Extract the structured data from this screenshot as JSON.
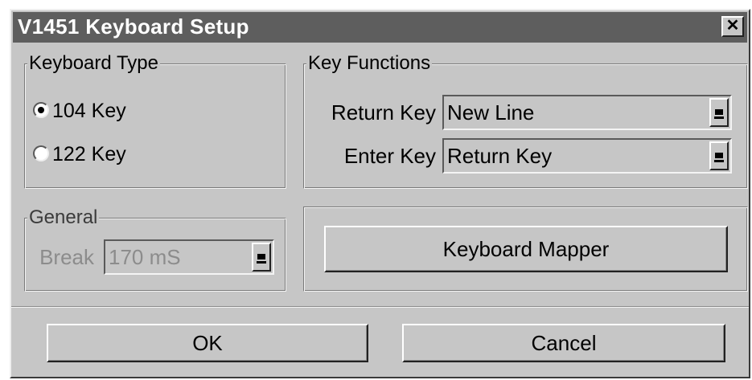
{
  "window": {
    "title": "V1451 Keyboard Setup",
    "close_glyph": "✕"
  },
  "keyboard_type": {
    "legend": "Keyboard Type",
    "options": [
      {
        "label": "104 Key",
        "checked": true
      },
      {
        "label": "122 Key",
        "checked": false
      }
    ]
  },
  "key_functions": {
    "legend": "Key Functions",
    "return_key": {
      "label": "Return Key",
      "value": "New Line"
    },
    "enter_key": {
      "label": "Enter Key",
      "value": "Return Key"
    }
  },
  "general": {
    "legend": "General",
    "break": {
      "label": "Break",
      "value": "170 mS",
      "disabled": true
    }
  },
  "mapper": {
    "button_label": "Keyboard Mapper"
  },
  "footer": {
    "ok_label": "OK",
    "cancel_label": "Cancel"
  }
}
